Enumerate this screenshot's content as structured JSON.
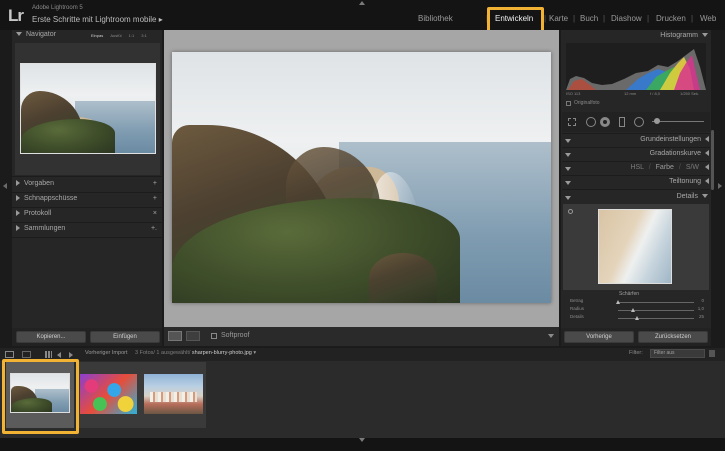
{
  "app": {
    "logo": "Lr",
    "subtitle": "Adobe Lightroom 5",
    "title": "Erste Schritte mit Lightroom mobile",
    "title_arrow": "▸"
  },
  "modules": [
    {
      "label": "Bibliothek",
      "active": false
    },
    {
      "label": "Entwickeln",
      "active": true
    },
    {
      "label": "Karte",
      "active": false
    },
    {
      "label": "Buch",
      "active": false
    },
    {
      "label": "Diashow",
      "active": false
    },
    {
      "label": "Drucken",
      "active": false
    },
    {
      "label": "Web",
      "active": false
    }
  ],
  "highlight_color": "#f2b233",
  "left_panel": {
    "navigator": {
      "title": "Navigator",
      "zoom_options": [
        "Einpas",
        "Ausfül",
        "1:1",
        "3:1"
      ]
    },
    "sections": [
      {
        "label": "Vorgaben",
        "action": "+"
      },
      {
        "label": "Schnappschüsse",
        "action": "+"
      },
      {
        "label": "Protokoll",
        "action": "×"
      },
      {
        "label": "Sammlungen",
        "action": "+."
      }
    ],
    "buttons": {
      "copy": "Kopieren...",
      "paste": "Einfügen"
    }
  },
  "center": {
    "softproof_label": "Softproof"
  },
  "right_panel": {
    "histogram": {
      "title": "Histogramm",
      "readouts": [
        "ISO 113",
        "12 mm",
        "f / 8,0",
        "1/250 Sek."
      ],
      "original_label": "Originalfoto"
    },
    "sections": [
      {
        "label": "Grundeinstellungen"
      },
      {
        "label": "Gradationskurve"
      },
      {
        "label": "Teiltonung"
      },
      {
        "label": "Details"
      }
    ],
    "hsl_tabs": [
      "HSL",
      "Farbe",
      "S/W"
    ],
    "sharpen": {
      "heading": "Schärfen",
      "sliders": [
        {
          "label": "Betrag",
          "value": "0",
          "fraction": 0.0
        },
        {
          "label": "Radius",
          "value": "1,0",
          "fraction": 0.2
        },
        {
          "label": "Details",
          "value": "25",
          "fraction": 0.25
        }
      ]
    },
    "buttons": {
      "previous": "Vorherige",
      "reset": "Zurücksetzen"
    }
  },
  "filmstrip": {
    "source": "Vorheriger Import",
    "count": "3 Fotos/ 1 ausgewählt/",
    "filename": "sharpen-blurry-photo.jpg",
    "filter_label": "Filter:",
    "filter_value": "Filter aus"
  }
}
